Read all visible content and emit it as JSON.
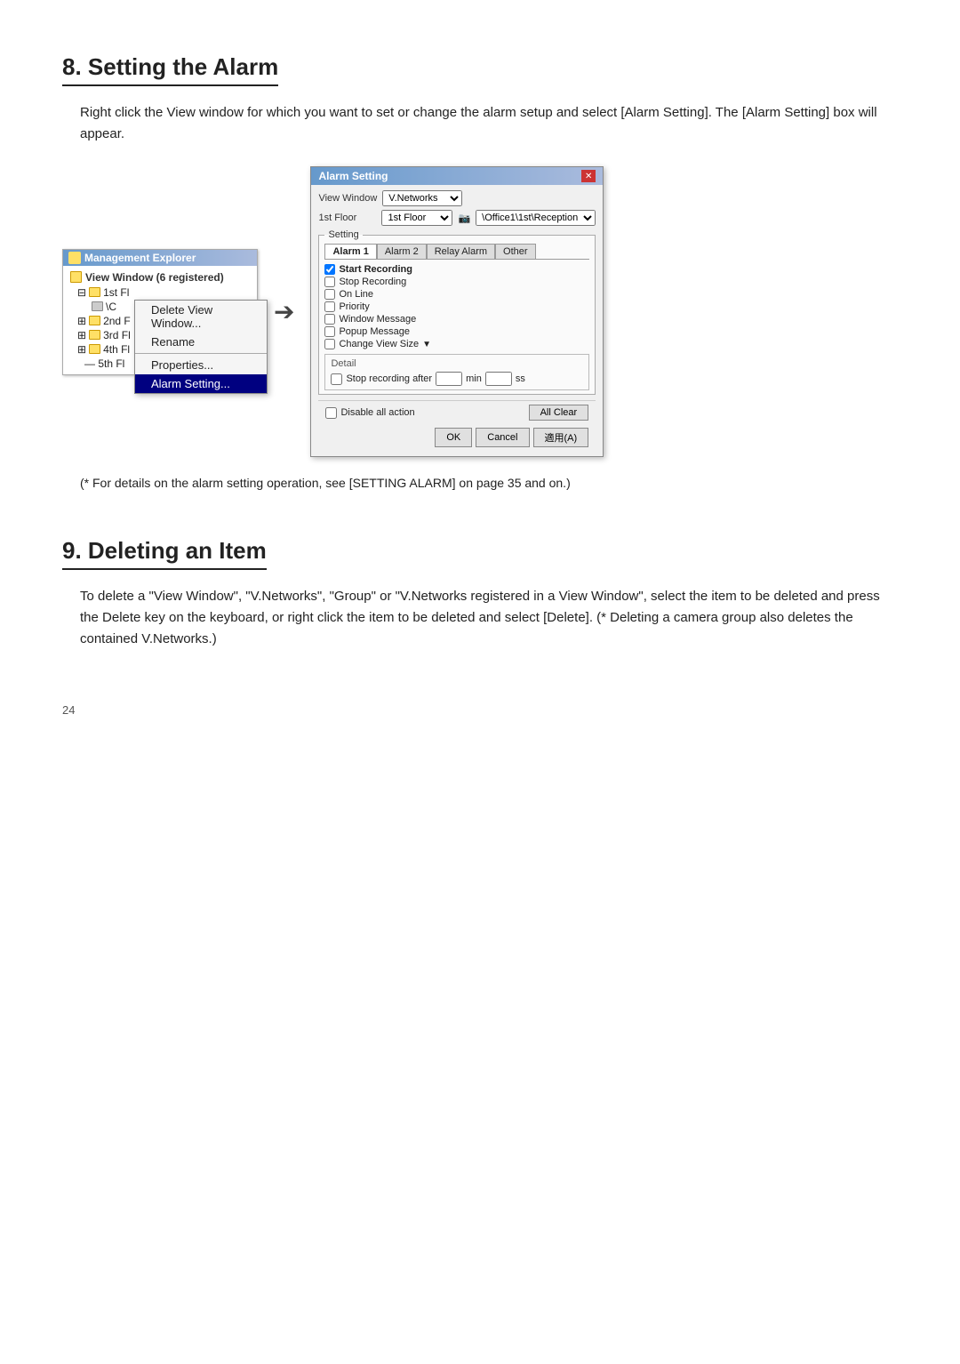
{
  "section8": {
    "heading": "8. Setting the Alarm",
    "body": "Right click the View window for which you want to set or change the alarm setup and select [Alarm Setting]. The [Alarm Setting] box will appear.",
    "note": "(* For details on the alarm setting operation, see [SETTING ALARM] on\n    page 35 and on.)",
    "mgmt_explorer": {
      "title": "Management Explorer",
      "subtitle": "View Window (6 registered)",
      "tree_items": [
        "1st Fl",
        "\\C",
        "2nd F",
        "3rd Fl",
        "4th Fl",
        "5th Fl"
      ],
      "context_menu": {
        "items": [
          {
            "label": "Delete View Window...",
            "active": false
          },
          {
            "label": "Rename",
            "active": false
          },
          {
            "label": "Properties...",
            "active": false
          },
          {
            "label": "Alarm Setting...",
            "active": true
          }
        ]
      }
    },
    "alarm_dialog": {
      "title": "Alarm Setting",
      "view_window_label": "View Window",
      "view_window_value": "V.Networks",
      "1st_floor_label": "1st Floor",
      "path_value": "\\Office1\\1st\\Reception",
      "setting_group": "Setting",
      "tabs": [
        "Alarm 1",
        "Alarm 2",
        "Relay Alarm",
        "Other"
      ],
      "active_tab": "Alarm 1",
      "checkboxes": [
        {
          "label": "Start Recording",
          "checked": true
        },
        {
          "label": "Stop Recording",
          "checked": false
        },
        {
          "label": "On Line",
          "checked": false
        },
        {
          "label": "Priority",
          "checked": false
        },
        {
          "label": "Window Message",
          "checked": false
        },
        {
          "label": "Popup Message",
          "checked": false
        },
        {
          "label": "Change View Size",
          "checked": false
        }
      ],
      "detail_label": "Detail",
      "stop_recording_label": "Stop recording after",
      "min_label": "min",
      "sec_label": "ss",
      "disable_label": "Disable all action",
      "all_clear_label": "All Clear",
      "ok_label": "OK",
      "cancel_label": "Cancel",
      "apply_label": "適用(A)"
    }
  },
  "section9": {
    "heading": "9. Deleting an Item",
    "body": "To delete a \"View Window\", \"V.Networks\", \"Group\" or \"V.Networks registered in a View Window\", select the item to be deleted and press the Delete key on the keyboard, or right click the item to be deleted and select [Delete].\n(* Deleting a camera group also deletes the contained V.Networks.)"
  },
  "page_number": "24"
}
